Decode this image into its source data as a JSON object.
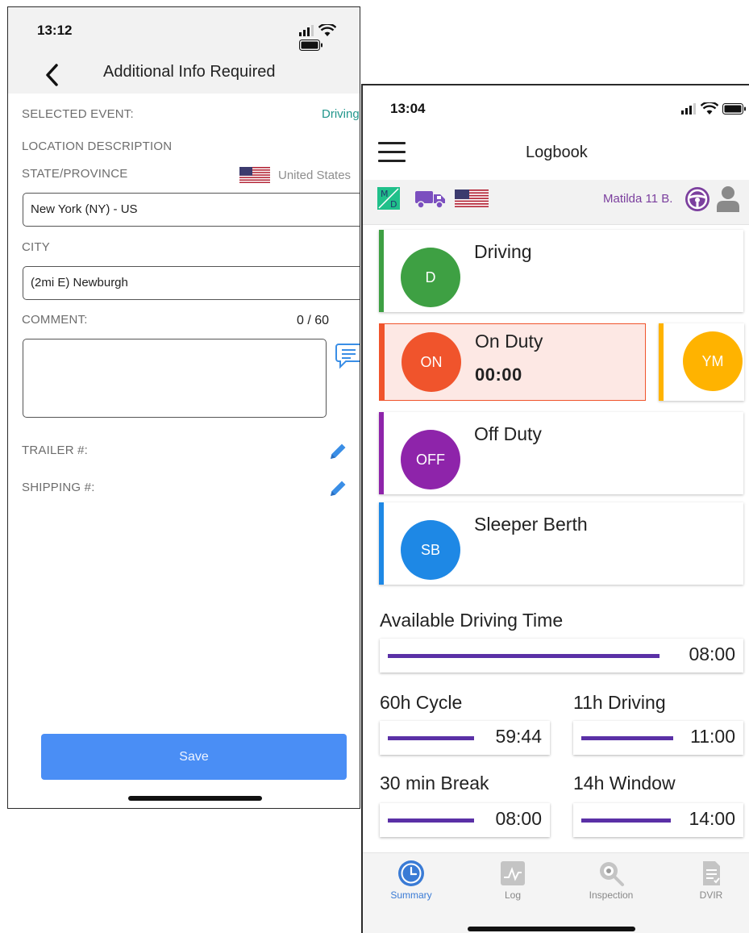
{
  "left_screen": {
    "status": {
      "time": "13:12"
    },
    "header": {
      "title": "Additional Info Required"
    },
    "selected_event": {
      "label": "SELECTED EVENT:",
      "value": "Driving"
    },
    "location_description": {
      "label": "LOCATION DESCRIPTION"
    },
    "state_province": {
      "label": "STATE/PROVINCE",
      "country": "United States",
      "value": "New York (NY) - US"
    },
    "city": {
      "label": "CITY",
      "value": "(2mi E) Newburgh"
    },
    "comment": {
      "label": "COMMENT:",
      "counter": "0 / 60",
      "value": ""
    },
    "trailer": {
      "label": "TRAILER #:"
    },
    "shipping": {
      "label": "SHIPPING #:"
    },
    "save_label": "Save"
  },
  "right_screen": {
    "status": {
      "time": "13:04"
    },
    "header": {
      "title": "Logbook"
    },
    "info": {
      "md_badge_top": "M",
      "md_badge_bottom": "D",
      "driver": "Matilda 11 B."
    },
    "statuses": {
      "driving": {
        "abbr": "D",
        "title": "Driving",
        "color": "#3ea043"
      },
      "on_duty": {
        "abbr": "ON",
        "title": "On Duty",
        "timer": "00:00",
        "color": "#f0542c"
      },
      "yard_move": {
        "abbr": "YM",
        "color": "#ffb300"
      },
      "off_duty": {
        "abbr": "OFF",
        "title": "Off Duty",
        "color": "#8e24aa"
      },
      "sleeper": {
        "abbr": "SB",
        "title": "Sleeper Berth",
        "color": "#1e88e5"
      }
    },
    "clocks": {
      "available": {
        "label": "Available Driving Time",
        "value": "08:00",
        "fraction": 1.0
      },
      "cycle": {
        "label": "60h Cycle",
        "value": "59:44",
        "fraction": 0.996
      },
      "driving": {
        "label": "11h Driving",
        "value": "11:00",
        "fraction": 1.0
      },
      "break": {
        "label": "30 min Break",
        "value": "08:00",
        "fraction": 1.0
      },
      "window": {
        "label": "14h Window",
        "value": "14:00",
        "fraction": 1.0
      }
    },
    "tabs": [
      {
        "label": "Summary",
        "icon": "clock-icon",
        "active": true
      },
      {
        "label": "Log",
        "icon": "chart-icon",
        "active": false
      },
      {
        "label": "Inspection",
        "icon": "magnifier-gear-icon",
        "active": false
      },
      {
        "label": "DVIR",
        "icon": "document-icon",
        "active": false
      }
    ],
    "colors": {
      "accent": "#3a7bd5",
      "progress": "#5a30a6",
      "driver_name": "#7b3f9e"
    }
  }
}
